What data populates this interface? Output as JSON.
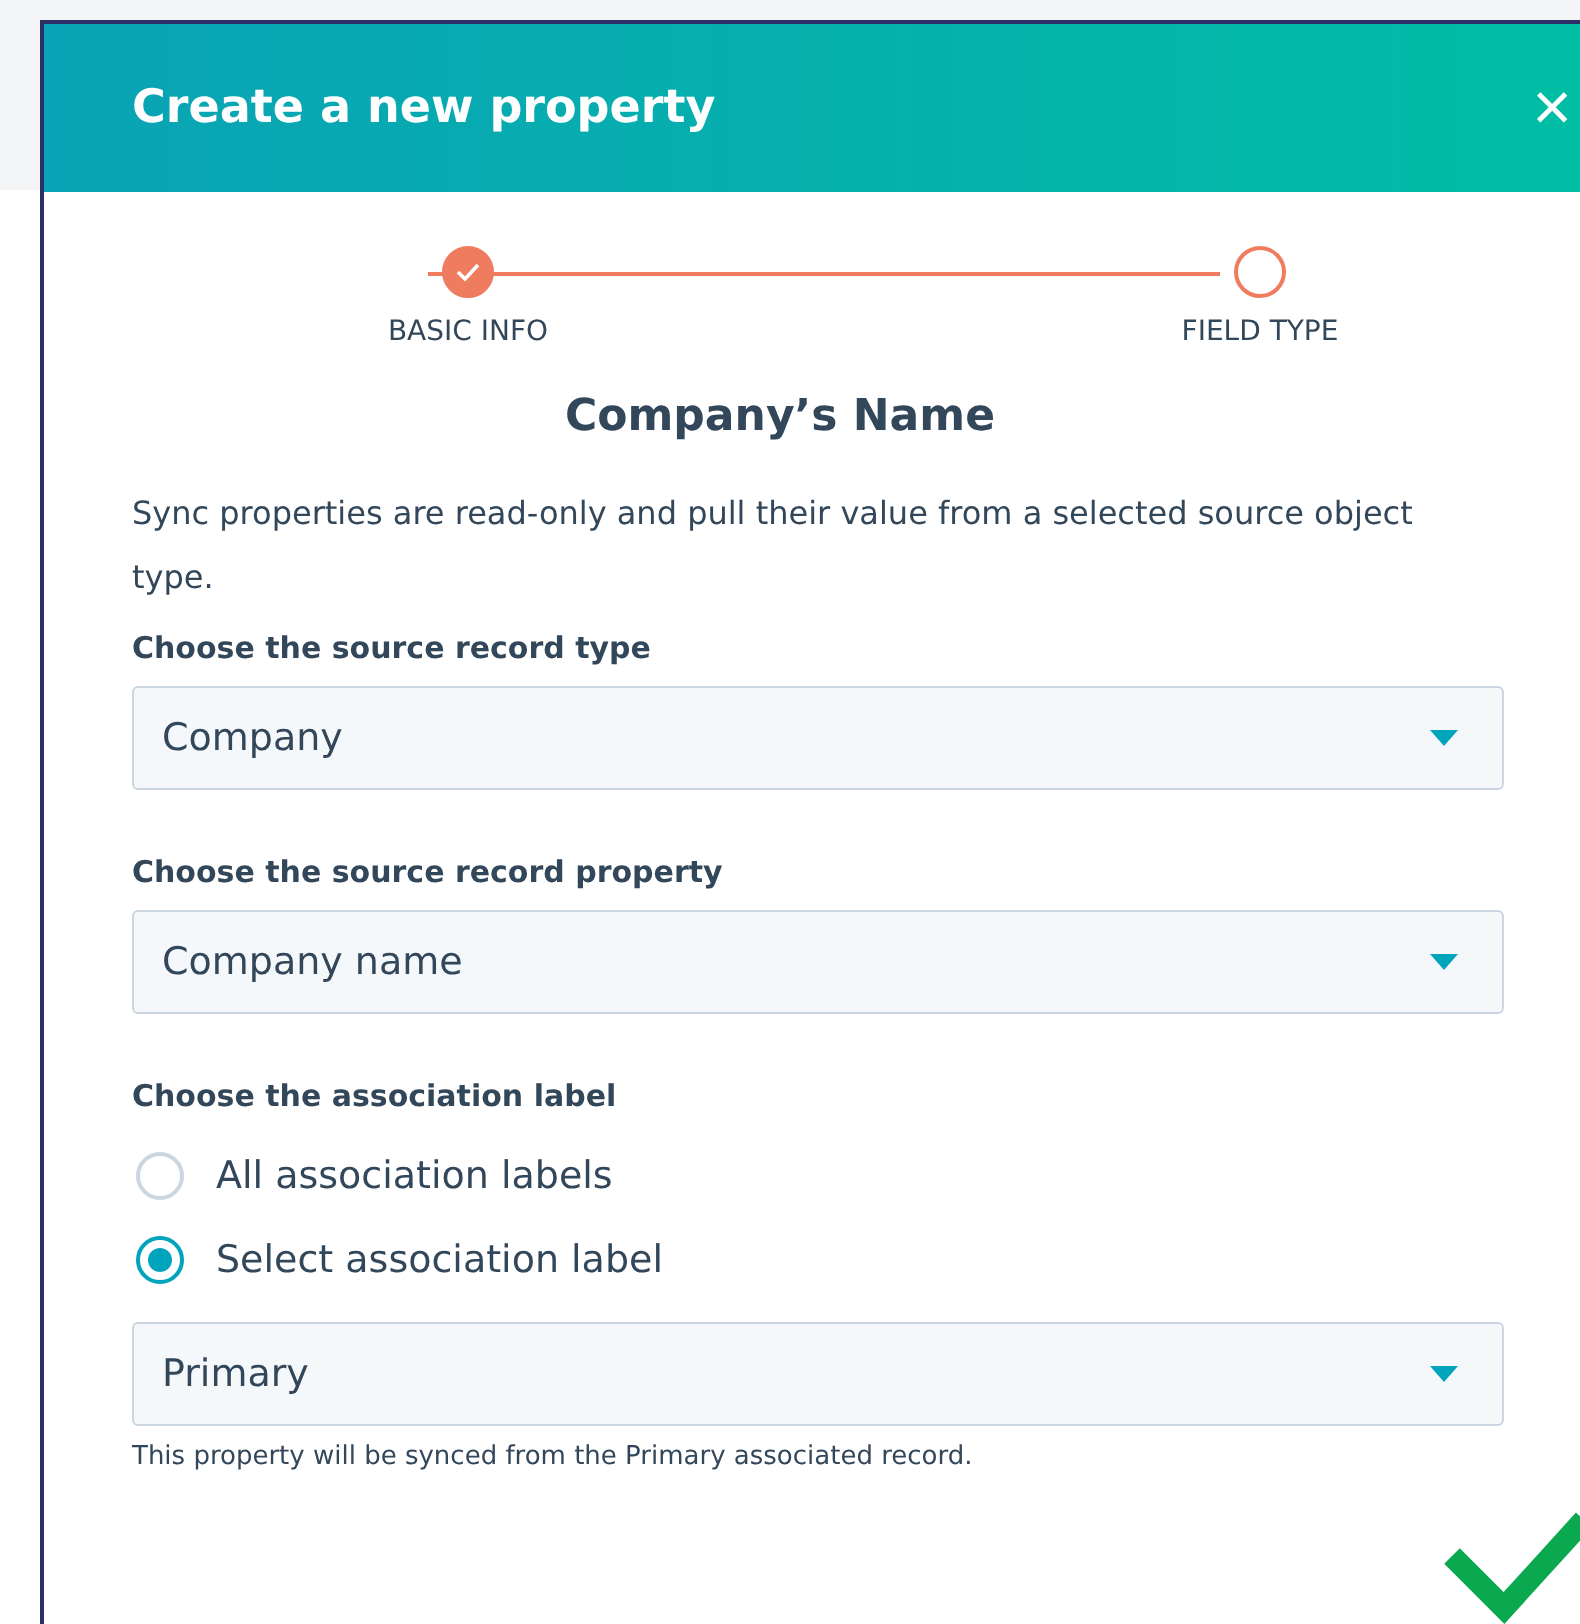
{
  "dialog": {
    "title": "Create a new property",
    "close_label": "×"
  },
  "steps": [
    {
      "label": "BASIC INFO",
      "done": true
    },
    {
      "label": "FIELD TYPE",
      "done": false
    }
  ],
  "heading": "Company’s Name",
  "description": "Sync properties are read-only and pull their value from a selected source object type.",
  "sections": [
    {
      "kind": "select",
      "label": "Choose the source record type",
      "value": "Company"
    },
    {
      "kind": "select",
      "label": "Choose the source record property",
      "value": "Company name"
    },
    {
      "kind": "radio_group",
      "label": "Choose the association label",
      "options": [
        {
          "label": "All association labels",
          "selected": false
        },
        {
          "label": "Select association label",
          "selected": true
        }
      ]
    },
    {
      "kind": "select",
      "value": "Primary",
      "hint": "This property will be synced from the Primary associated record."
    }
  ]
}
